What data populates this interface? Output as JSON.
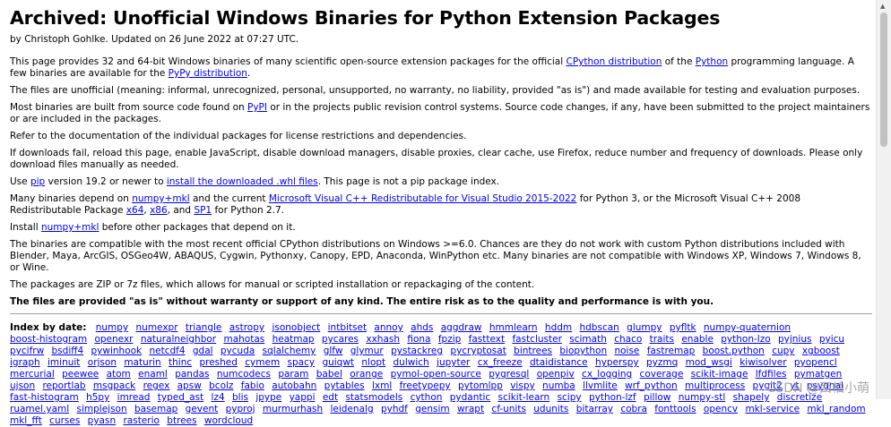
{
  "title": "Archived: Unofficial Windows Binaries for Python Extension Packages",
  "byline": "by Christoph Gohlke. Updated on 26 June 2022 at 07:27 UTC.",
  "p1": {
    "t1": "This page provides 32 and 64-bit Windows binaries of many scientific open-source extension packages for the official ",
    "l1": "CPython distribution",
    "t2": " of the ",
    "l2": "Python",
    "t3": " programming language. A few binaries are available for the ",
    "l3": "PyPy distribution",
    "t4": "."
  },
  "p2": "The files are unofficial (meaning: informal, unrecognized, personal, unsupported, no warranty, no liability, provided \"as is\") and made available for testing and evaluation purposes.",
  "p3": {
    "t1": "Most binaries are built from source code found on ",
    "l1": "PyPI",
    "t2": " or in the projects public revision control systems. Source code changes, if any, have been submitted to the project maintainers or are included in the packages."
  },
  "p4": "Refer to the documentation of the individual packages for license restrictions and dependencies.",
  "p5": "If downloads fail, reload this page, enable JavaScript, disable download managers, disable proxies, clear cache, use Firefox, reduce number and frequency of downloads. Please only download files manually as needed.",
  "p6": {
    "t1": "Use ",
    "l1": "pip",
    "t2": " version 19.2 or newer to ",
    "l2": "install the downloaded .whl files",
    "t3": ". This page is not a pip package index."
  },
  "p7": {
    "t1": "Many binaries depend on ",
    "l1": "numpy+mkl",
    "t2": " and the current ",
    "l2": "Microsoft Visual C++ Redistributable for Visual Studio 2015-2022",
    "t3": " for Python 3, or the Microsoft Visual C++ 2008 Redistributable Package ",
    "l3": "x64",
    "t4": ", ",
    "l4": "x86",
    "t5": ", and ",
    "l5": "SP1",
    "t6": " for Python 2.7."
  },
  "p8": {
    "t1": "Install ",
    "l1": "numpy+mkl",
    "t2": " before other packages that depend on it."
  },
  "p9": "The binaries are compatible with the most recent official CPython distributions on Windows >=6.0. Chances are they do not work with custom Python distributions included with Blender, Maya, ArcGIS, OSGeo4W, ABAQUS, Cygwin, Pythonxy, Canopy, EPD, Anaconda, WinPython etc. Many binaries are not compatible with Windows XP, Windows 7, Windows 8, or Wine.",
  "p10": "The packages are ZIP or 7z files, which allows for manual or scripted installation or repackaging of the content.",
  "p11": "The files are provided \"as is\" without warranty or support of any kind. The entire risk as to the quality and performance is with you.",
  "index_label": "Index by date:",
  "packages": [
    "numpy",
    "numexpr",
    "triangle",
    "astropy",
    "jsonobject",
    "intbitset",
    "annoy",
    "ahds",
    "aggdraw",
    "hmmlearn",
    "hddm",
    "hdbscan",
    "glumpy",
    "pyfltk",
    "numpy-quaternion",
    "boost-histogram",
    "openexr",
    "naturalneighbor",
    "mahotas",
    "heatmap",
    "pycares",
    "xxhash",
    "fiona",
    "fpzip",
    "fasttext",
    "fastcluster",
    "scimath",
    "chaco",
    "traits",
    "enable",
    "python-lzo",
    "pyjnius",
    "pyicu",
    "pycifrw",
    "bsdiff4",
    "pywinhook",
    "netcdf4",
    "gdal",
    "pycuda",
    "sqlalchemy",
    "glfw",
    "glymur",
    "pystackreg",
    "pycryptosat",
    "bintrees",
    "biopython",
    "noise",
    "fastremap",
    "boost.python",
    "cupy",
    "xgboost",
    "igraph",
    "iminuit",
    "orjson",
    "maturin",
    "thinc",
    "preshed",
    "cymem",
    "spacy",
    "guiqwt",
    "nlopt",
    "dulwich",
    "jupyter",
    "cx_freeze",
    "dtaidistance",
    "hyperspy",
    "pyzmq",
    "mod_wsgi",
    "kiwisolver",
    "pyopencl",
    "mercurial",
    "peewee",
    "atom",
    "enaml",
    "pandas",
    "numcodecs",
    "param",
    "babel",
    "orange",
    "pymol-open-source",
    "pygresql",
    "openpiv",
    "cx_logging",
    "coverage",
    "scikit-image",
    "lfdfiles",
    "pymatgen",
    "ujson",
    "reportlab",
    "msgpack",
    "regex",
    "apsw",
    "bcolz",
    "fabio",
    "autobahn",
    "pytables",
    "lxml",
    "freetypepy",
    "pytomlpp",
    "vispy",
    "numba",
    "llvmlite",
    "wrf_python",
    "multiprocess",
    "pygit2",
    "yt",
    "psygnal",
    "fast-histogram",
    "h5py",
    "imread",
    "typed_ast",
    "lz4",
    "blis",
    "jpype",
    "yappi",
    "edt",
    "statsmodels",
    "cython",
    "pydantic",
    "scikit-learn",
    "scipy",
    "python-lzf",
    "pillow",
    "numpy-stl",
    "shapely",
    "discretize",
    "ruamel.yaml",
    "simplejson",
    "basemap",
    "gevent",
    "pyproj",
    "murmurhash",
    "leidenalg",
    "pyhdf",
    "gensim",
    "wrapt",
    "cf-units",
    "udunits",
    "bitarray",
    "cobra",
    "fonttools",
    "opencv",
    "mkl-service",
    "mkl_random",
    "mkl_fft",
    "curses",
    "pyasn",
    "rasterio",
    "btrees",
    "wordcloud"
  ],
  "watermark": "CSDN @西柚小萌"
}
